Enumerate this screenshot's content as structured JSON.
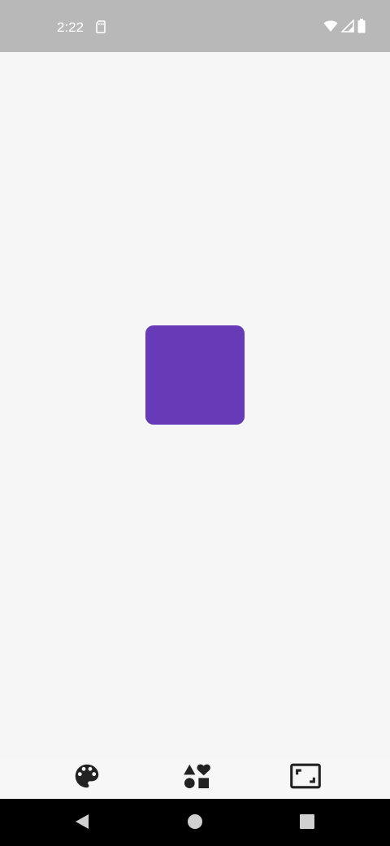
{
  "status_bar": {
    "time": "2:22",
    "icons": [
      "sd-card-icon",
      "wifi-icon",
      "signal-icon",
      "battery-icon"
    ]
  },
  "canvas": {
    "shape": "rounded-square",
    "fill_color": "#673ab7"
  },
  "toolbar": {
    "items": [
      {
        "name": "palette",
        "icon": "palette-icon"
      },
      {
        "name": "shapes",
        "icon": "shapes-icon"
      },
      {
        "name": "aspect-ratio",
        "icon": "aspect-ratio-icon"
      }
    ]
  },
  "navigation": {
    "buttons": [
      "back",
      "home",
      "recents"
    ]
  },
  "colors": {
    "accent": "#673ab7",
    "status_bar": "#b8b8b8",
    "background": "#f6f6f6",
    "nav_bar": "#000000",
    "icon": "#222222"
  }
}
